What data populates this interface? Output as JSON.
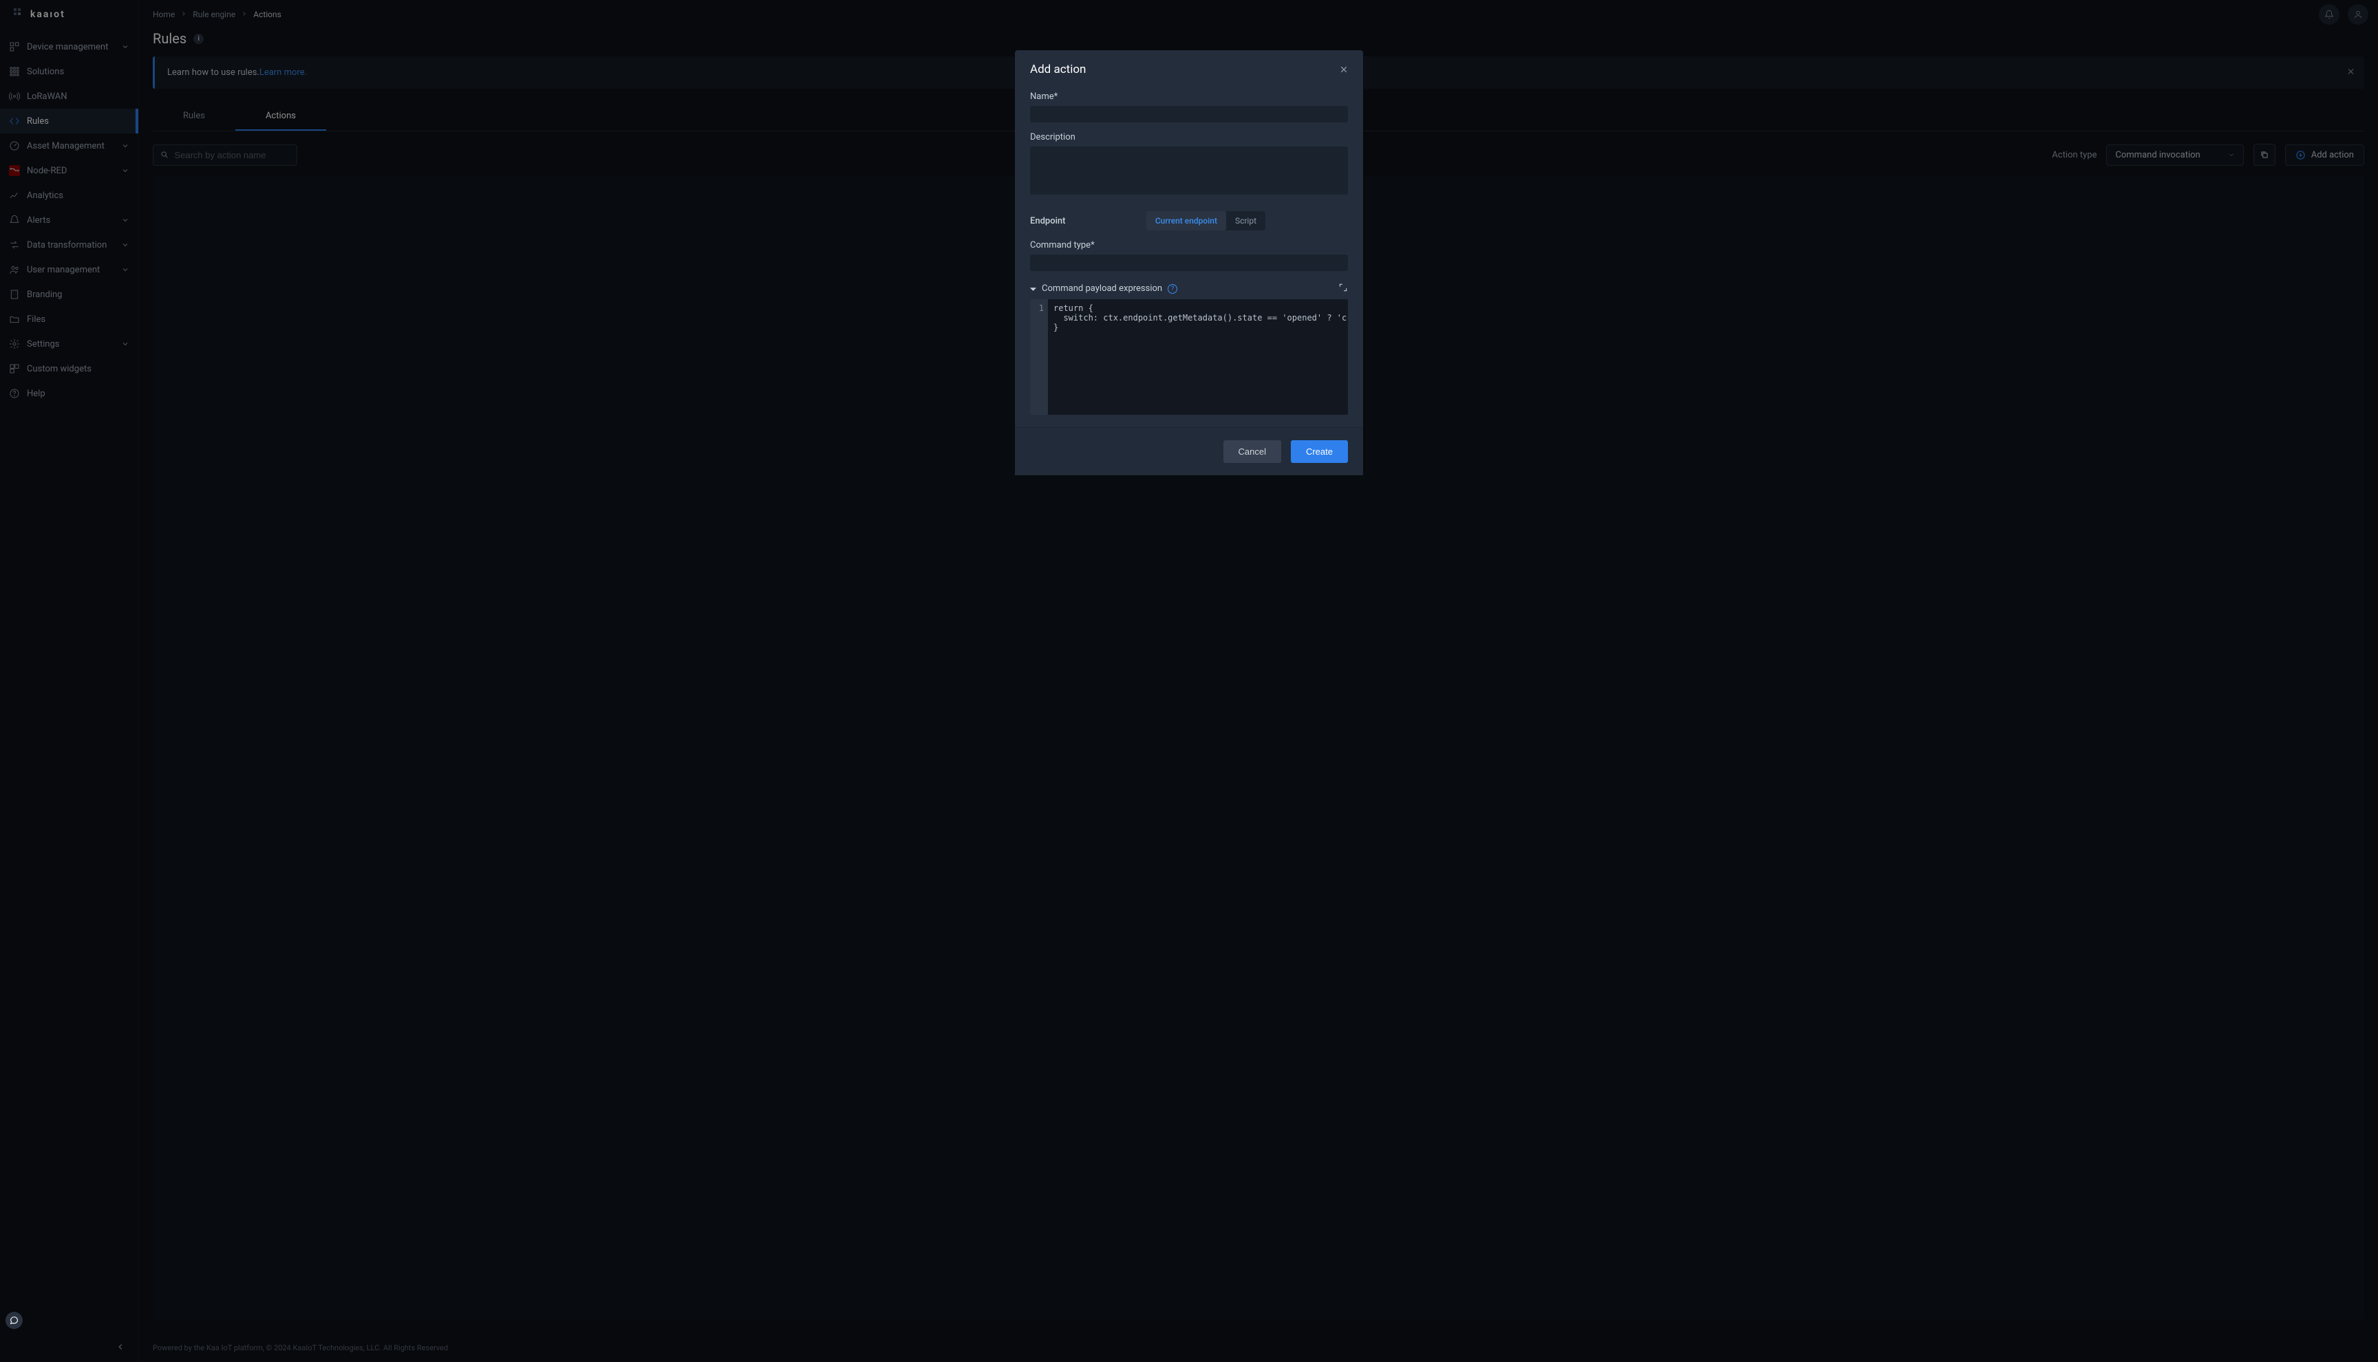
{
  "logo_text": "kaaıot",
  "sidebar": {
    "items": [
      {
        "label": "Device management",
        "icon": "devices",
        "expandable": true
      },
      {
        "label": "Solutions",
        "icon": "grid",
        "expandable": false
      },
      {
        "label": "LoRaWAN",
        "icon": "antenna",
        "expandable": false
      },
      {
        "label": "Rules",
        "icon": "code",
        "expandable": false,
        "active": true
      },
      {
        "label": "Asset Management",
        "icon": "gauge",
        "expandable": true
      },
      {
        "label": "Node-RED",
        "icon": "nodered",
        "expandable": true
      },
      {
        "label": "Analytics",
        "icon": "chart",
        "expandable": false
      },
      {
        "label": "Alerts",
        "icon": "bell",
        "expandable": true
      },
      {
        "label": "Data transformation",
        "icon": "transform",
        "expandable": true
      },
      {
        "label": "User management",
        "icon": "users",
        "expandable": true
      },
      {
        "label": "Branding",
        "icon": "building",
        "expandable": false
      },
      {
        "label": "Files",
        "icon": "folder",
        "expandable": false
      },
      {
        "label": "Settings",
        "icon": "gear",
        "expandable": true
      },
      {
        "label": "Custom widgets",
        "icon": "widgets",
        "expandable": false
      },
      {
        "label": "Help",
        "icon": "help",
        "expandable": false
      }
    ]
  },
  "breadcrumbs": [
    {
      "label": "Home"
    },
    {
      "label": "Rule engine"
    },
    {
      "label": "Actions",
      "current": true
    }
  ],
  "page_title": "Rules",
  "info_badge": "i",
  "banner": {
    "text": "Learn how to use rules. ",
    "link": "Learn more."
  },
  "tabs": [
    {
      "label": "Rules"
    },
    {
      "label": "Actions",
      "active": true
    }
  ],
  "search_placeholder": "Search by action name",
  "action_type_label": "Action type",
  "action_type_value": "Command invocation",
  "add_action_label": "Add action",
  "footer_text": "Powered by the Kaa IoT platform, © 2024 KaaIoT Technologies, LLC. All Rights Reserved",
  "modal": {
    "title": "Add action",
    "name_label": "Name*",
    "description_label": "Description",
    "endpoint_label": "Endpoint",
    "endpoint_options": [
      "Current endpoint",
      "Script"
    ],
    "command_type_label": "Command type*",
    "expression_label": "Command payload expression",
    "help_glyph": "?",
    "gutter_line": "1",
    "code_text": "return {\n  switch: ctx.endpoint.getMetadata().state == 'opened' ? 'c\n}",
    "cancel_label": "Cancel",
    "create_label": "Create"
  }
}
